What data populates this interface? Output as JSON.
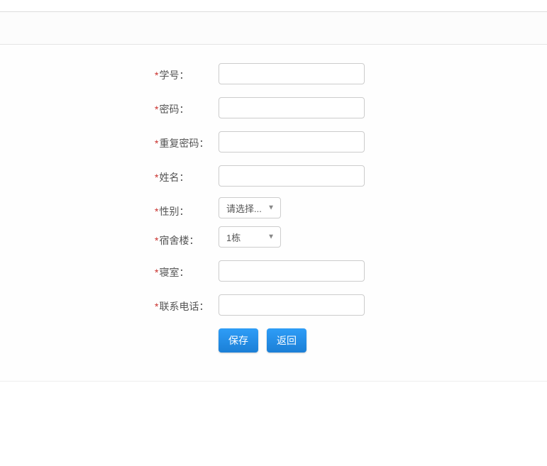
{
  "form": {
    "fields": {
      "student_id": {
        "label": "学号：",
        "value": ""
      },
      "password": {
        "label": "密码：",
        "value": ""
      },
      "password_confirm": {
        "label": "重复密码：",
        "value": ""
      },
      "name": {
        "label": "姓名：",
        "value": ""
      },
      "gender": {
        "label": "性别：",
        "selected": "请选择..."
      },
      "dormitory_building": {
        "label": "宿舍楼：",
        "selected": "1栋"
      },
      "dorm_room": {
        "label": "寝室：",
        "value": ""
      },
      "phone": {
        "label": "联系电话：",
        "value": ""
      }
    },
    "buttons": {
      "save": "保存",
      "back": "返回"
    }
  }
}
